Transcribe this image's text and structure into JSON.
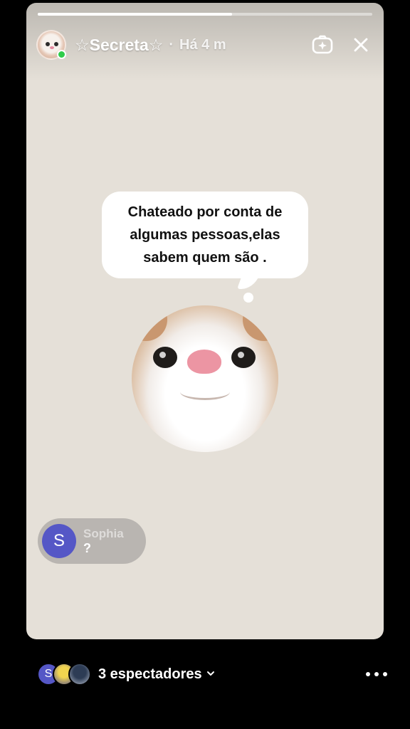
{
  "story": {
    "progress": 0.58,
    "username": "☆Secreta☆",
    "time_separator": "·",
    "time_ago": "Há 4 m",
    "online": true,
    "bubble_text": "Chateado por conta de algumas pessoas,elas sabem quem são .",
    "reply": {
      "avatar_initial": "S",
      "name": "Sophia",
      "message": "?"
    }
  },
  "icons": {
    "add_sticker": "sparkle-frame-icon",
    "close": "close-icon",
    "chevron": "chevron-down-icon",
    "more": "more-horizontal-icon"
  },
  "footer": {
    "viewer_initial": "S",
    "viewers_label": "3 espectadores"
  },
  "colors": {
    "story_background": "#e5e0d8",
    "online_dot": "#2ecc4a",
    "reply_avatar": "#5557c6"
  }
}
